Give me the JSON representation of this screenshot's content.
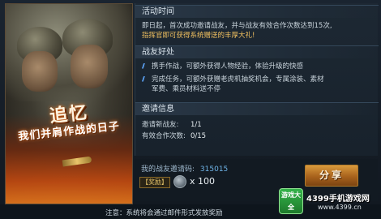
{
  "banner": {
    "title": "追忆",
    "subtitle": "我们并肩作战的日子"
  },
  "activity_time": {
    "heading": "活动时间",
    "line1_prefix": "即日起，首次成功邀请战友，并与战友有效合作次数达到15次,",
    "line2": "指挥官即可获得系统赠送的丰厚大礼!"
  },
  "benefits": {
    "heading": "战友好处",
    "items": [
      "携手作战，可额外获得人物经验，体验升级的快感",
      "完成任务，可额外获赠老虎机抽奖机会，专属涂装、素材",
      "军费、乘员材料送不停"
    ]
  },
  "invite_info": {
    "heading": "邀请信息",
    "new_friends_label": "邀请新战友:",
    "new_friends_value": "1/1",
    "coop_label": "有效合作次数:",
    "coop_value": "0/15"
  },
  "invite_code": {
    "label": "我的战友邀请码:",
    "code": "315015"
  },
  "reward": {
    "tag": "【奖励】",
    "count": "x 100",
    "icon": "coin-icon"
  },
  "share_button": {
    "label": "分享"
  },
  "footer": {
    "note": "注意：系统将会通过邮件形式发放奖励"
  },
  "watermark": {
    "badge": "游戏大全",
    "title": "4399手机游戏网",
    "url": "www.4399.cn"
  },
  "colors": {
    "highlight": "#f0c060",
    "accent_blue": "#6fb4e8",
    "button": "#d99a3c"
  }
}
